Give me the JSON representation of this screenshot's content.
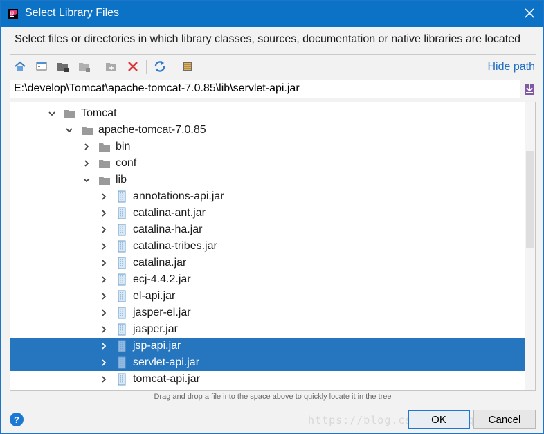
{
  "window": {
    "title": "Select Library Files"
  },
  "description": "Select files or directories in which library classes, sources, documentation or native libraries are located",
  "toolbar": {
    "buttons": [
      {
        "icon": "home-icon"
      },
      {
        "icon": "desktop-icon"
      },
      {
        "icon": "project-folder-icon"
      },
      {
        "icon": "module-folder-icon"
      },
      {
        "icon": "new-folder-icon"
      },
      {
        "icon": "delete-icon"
      },
      {
        "icon": "refresh-icon"
      },
      {
        "icon": "show-hidden-icon"
      }
    ],
    "hide_path_label": "Hide path"
  },
  "path": {
    "value": "E:\\develop\\Tomcat\\apache-tomcat-7.0.85\\lib\\servlet-api.jar"
  },
  "tree": {
    "rows": [
      {
        "label": "Tomcat",
        "expanded": true,
        "type": "folder"
      },
      {
        "label": "apache-tomcat-7.0.85",
        "expanded": true,
        "type": "folder"
      },
      {
        "label": "bin",
        "expanded": false,
        "type": "folder"
      },
      {
        "label": "conf",
        "expanded": false,
        "type": "folder"
      },
      {
        "label": "lib",
        "expanded": true,
        "type": "folder"
      },
      {
        "label": "annotations-api.jar",
        "expanded": false,
        "type": "jar"
      },
      {
        "label": "catalina-ant.jar",
        "expanded": false,
        "type": "jar"
      },
      {
        "label": "catalina-ha.jar",
        "expanded": false,
        "type": "jar"
      },
      {
        "label": "catalina-tribes.jar",
        "expanded": false,
        "type": "jar"
      },
      {
        "label": "catalina.jar",
        "expanded": false,
        "type": "jar"
      },
      {
        "label": "ecj-4.4.2.jar",
        "expanded": false,
        "type": "jar"
      },
      {
        "label": "el-api.jar",
        "expanded": false,
        "type": "jar"
      },
      {
        "label": "jasper-el.jar",
        "expanded": false,
        "type": "jar"
      },
      {
        "label": "jasper.jar",
        "expanded": false,
        "type": "jar"
      },
      {
        "label": "jsp-api.jar",
        "expanded": false,
        "type": "jar",
        "selected": true
      },
      {
        "label": "servlet-api.jar",
        "expanded": false,
        "type": "jar",
        "selected": true
      },
      {
        "label": "tomcat-api.jar",
        "expanded": false,
        "type": "jar"
      }
    ]
  },
  "hint": "Drag and drop a file into the space above to quickly locate it in the tree",
  "footer": {
    "ok_label": "OK",
    "cancel_label": "Cancel",
    "watermark": "https://blog.csdn.net/qq_4    00"
  },
  "colors": {
    "title_bar": "#0b72c5",
    "selection": "#2675bf",
    "link": "#1f6ec4"
  }
}
